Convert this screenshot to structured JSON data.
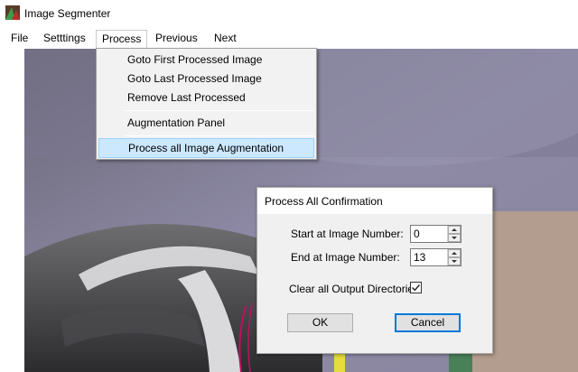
{
  "window": {
    "title": "Image Segmenter",
    "icon": "app-segmenter-icon"
  },
  "menubar": {
    "items": [
      "File",
      "Setttings",
      "Process",
      "Previous",
      "Next"
    ],
    "open_menu": "Process"
  },
  "process_menu": {
    "items": [
      {
        "label": "Goto First Processed Image"
      },
      {
        "label": "Goto Last Processed Image"
      },
      {
        "label": "Remove Last Processed"
      },
      {
        "label": "Augmentation Panel"
      },
      {
        "label": "Process all Image Augmentation",
        "highlighted": true
      }
    ]
  },
  "dialog": {
    "title": "Process All Confirmation",
    "start_label": "Start at Image Number:",
    "start_value": "0",
    "end_label": "End at Image Number:",
    "end_value": "13",
    "clear_label": "Clear all Output Directories",
    "clear_checked": true,
    "ok_label": "OK",
    "cancel_label": "Cancel"
  },
  "colors": {
    "highlight": "#cce8ff",
    "highlight_border": "#99d1ff",
    "focus": "#0078d7"
  }
}
